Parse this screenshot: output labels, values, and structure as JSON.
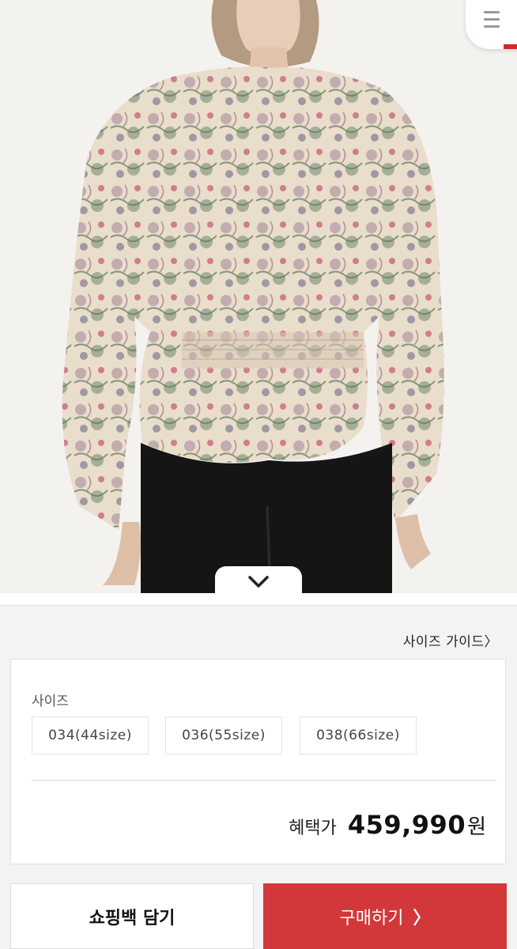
{
  "product": {
    "image_alt": "floral ruffle blouse"
  },
  "size_guide": {
    "label": "사이즈 가이드",
    "chevron": "〉"
  },
  "options": {
    "size_label": "사이즈",
    "sizes": [
      "034(44size)",
      "036(55size)",
      "038(66size)"
    ]
  },
  "price": {
    "label": "혜택가",
    "value": "459,990",
    "unit": "원"
  },
  "actions": {
    "bag_label": "쇼핑백 담기",
    "buy_label": "구매하기",
    "buy_chevron": "〉"
  },
  "colors": {
    "accent": "#d2383a",
    "background": "#f3f3f3"
  },
  "icons": {
    "menu": "hamburger-menu-icon",
    "collapse": "chevron-down-icon"
  }
}
